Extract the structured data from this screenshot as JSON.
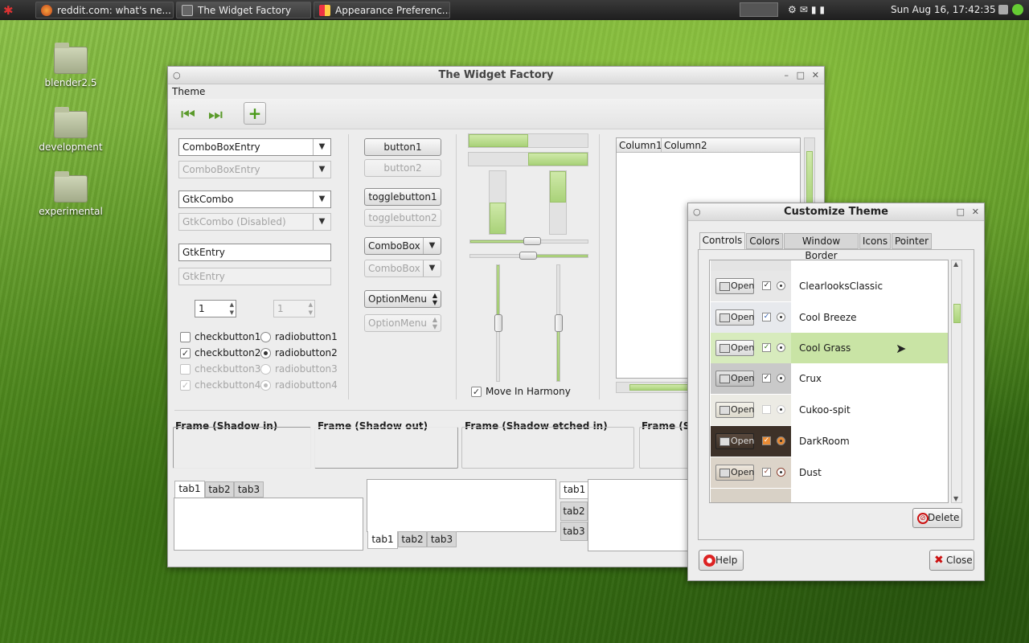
{
  "panel": {
    "tasks": [
      "reddit.com: what's ne...",
      "The Widget Factory",
      "Appearance Preferenc..."
    ],
    "clock": "Sun Aug 16, 17:42:35"
  },
  "desktop": {
    "icons": [
      "blender2.5",
      "development",
      "experimental"
    ]
  },
  "widget_factory": {
    "title": "The Widget Factory",
    "menu": "Theme",
    "toolbar_icons": [
      "go-first-icon",
      "go-last-icon",
      "add-icon"
    ],
    "combo1": "ComboBoxEntry",
    "combo1_dis": "ComboBoxEntry",
    "combo2": "GtkCombo",
    "combo2_dis": "GtkCombo (Disabled)",
    "entry1": "GtkEntry",
    "entry1_dis": "GtkEntry",
    "spin1": "1",
    "spin2": "1",
    "checkbuttons": [
      "checkbutton1",
      "checkbutton2",
      "checkbutton3",
      "checkbutton4"
    ],
    "radiobuttons": [
      "radiobutton1",
      "radiobutton2",
      "radiobutton3",
      "radiobutton4"
    ],
    "button1": "button1",
    "button2": "button2",
    "toggle1": "togglebutton1",
    "toggle2": "togglebutton2",
    "combobox1": "ComboBox",
    "combobox2": "ComboBox",
    "option1": "OptionMenu",
    "option2": "OptionMenu",
    "harmony": "Move In Harmony",
    "progress": {
      "h1": 0.5,
      "h2": 0.5,
      "v1": 0.5,
      "v2": 0.5
    },
    "col1": "Column1",
    "col2": "Column2",
    "frames": [
      "Frame (Shadow in)",
      "Frame (Shadow out)",
      "Frame (Shadow etched in)",
      "Frame (Sh"
    ],
    "tabs": [
      "tab1",
      "tab2",
      "tab3"
    ]
  },
  "customize": {
    "title": "Customize Theme",
    "tabs": [
      "Controls",
      "Colors",
      "Window Border",
      "Icons",
      "Pointer"
    ],
    "open_label": "Open",
    "themes": [
      "ClearlooksClassic",
      "Cool Breeze",
      "Cool Grass",
      "Crux",
      "Cukoo-spit",
      "DarkRoom",
      "Dust"
    ],
    "selected": "Cool Grass",
    "delete": "Delete",
    "help": "Help",
    "close": "Close"
  },
  "colors": {
    "accent": "#c5e3a0",
    "selection": "#c9e4a5"
  }
}
